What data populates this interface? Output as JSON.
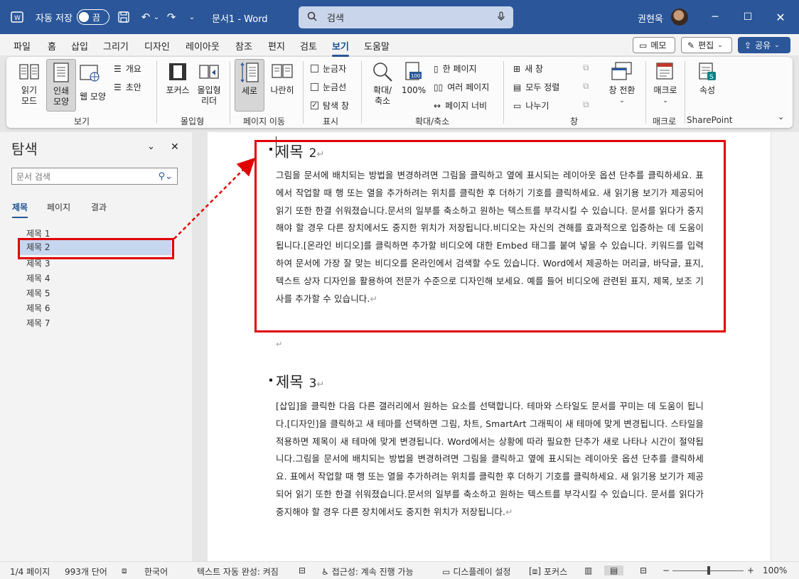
{
  "titlebar": {
    "autosave_label": "자동 저장",
    "autosave_state": "끔",
    "doc_title": "문서1  -  Word",
    "search_placeholder": "검색",
    "user_name": "권현욱"
  },
  "menu": {
    "items": [
      "파일",
      "홈",
      "삽입",
      "그리기",
      "디자인",
      "레이아웃",
      "참조",
      "편지",
      "검토",
      "보기",
      "도움말"
    ],
    "active": "보기",
    "memo": "메모",
    "edit": "편집",
    "share": "공유"
  },
  "ribbon": {
    "read_mode": "읽기\n모드",
    "print_layout": "인쇄\n모양",
    "web_layout": "웹 모양",
    "outline": "개요",
    "draft": "초안",
    "focus": "포커스",
    "immersive_reader": "몰입형\n리더",
    "vertical": "세로",
    "side_by_side": "나란히",
    "ruler": "눈금자",
    "gridlines": "눈금선",
    "nav_pane": "탐색 창",
    "zoom": "확대/\n축소",
    "zoom100": "100%",
    "one_page": "한 페이지",
    "multi_page": "여러 페이지",
    "page_width": "페이지 너비",
    "new_window": "새 창",
    "arrange_all": "모두 정렬",
    "split": "나누기",
    "switch_window": "창 전환",
    "macros": "매크로",
    "properties": "속성",
    "groups": {
      "views": "보기",
      "immersive": "몰입형",
      "page_movement": "페이지 이동",
      "show": "표시",
      "zoom": "확대/축소",
      "window": "창",
      "macros": "매크로",
      "sharepoint": "SharePoint"
    }
  },
  "nav": {
    "title": "탐색",
    "search_placeholder": "문서 검색",
    "tabs": [
      "제목",
      "페이지",
      "결과"
    ],
    "headings": [
      "제목 1",
      "제목 2",
      "제목 3",
      "제목 4",
      "제목 5",
      "제목 6",
      "제목 7"
    ],
    "selected": "제목 2"
  },
  "doc": {
    "heading2": {
      "title": "제목",
      "num": "2"
    },
    "heading3": {
      "title": "제목",
      "num": "3"
    },
    "para1": "그림을 문서에 배치되는 방법을 변경하려면 그림을 클릭하고 옆에 표시되는 레이아웃 옵션 단추를 클릭하세요. 표에서 작업할 때 행 또는 열을 추가하려는 위치를 클릭한 후 더하기 기호를 클릭하세요. 새 읽기용 보기가 제공되어 읽기 또한 한결 쉬워졌습니다.문서의 일부를 축소하고 원하는 텍스트를 부각시킬 수 있습니다. 문서를 읽다가 중지해야 할 경우 다른 장치에서도 중지한 위치가 저장됩니다.비디오는 자신의 견해를 효과적으로 입증하는 데 도움이 됩니다.[온라인 비디오]를 클릭하면 추가할 비디오에 대한 Embed 태그를 붙여 넣을 수 있습니다. 키워드를 입력하여 문서에 가장 잘 맞는 비디오를 온라인에서 검색할 수도 있습니다. Word에서 제공하는 머리글, 바닥글, 표지, 텍스트 상자 디자인을 활용하여 전문가 수준으로 디자인해 보세요. 예를 들어 비디오에 관련된 표지, 제목, 보조 기사를 추가할 수 있습니다.",
    "para2": "[삽입]을 클릭한 다음 다른 갤러리에서 원하는 요소를 선택합니다. 테마와 스타일도 문서를 꾸미는 데 도움이 됩니다.[디자인]을 클릭하고 새 테마를 선택하면 그림, 차트, SmartArt 그래픽이 새 테마에 맞게 변경됩니다. 스타일을 적용하면 제목이 새 테마에 맞게 변경됩니다. Word에서는 상황에 따라 필요한 단추가 새로 나타나 시간이 절약됩니다.그림을 문서에 배치되는 방법을 변경하려면 그림을 클릭하고 옆에 표시되는 레이아웃 옵션 단추를 클릭하세요. 표에서 작업할 때 행 또는 열을 추가하려는 위치를 클릭한 후 더하기 기호를 클릭하세요. 새 읽기용 보기가 제공되어 읽기 또한 한결 쉬워졌습니다.문서의 일부를 축소하고 원하는 텍스트를 부각시킬 수 있습니다. 문서를 읽다가 중지해야 할 경우 다른 장치에서도 중지한 위치가 저장됩니다."
  },
  "status": {
    "page": "1/4 페이지",
    "words": "993개 단어",
    "lang": "한국어",
    "autocomplete": "텍스트 자동 완성: 켜짐",
    "accessibility": "접근성: 계속 진행 가능",
    "display": "디스플레이 설정",
    "focus": "포커스",
    "zoom": "100%"
  },
  "colors": {
    "accent": "#2b579a",
    "highlight": "#e00000"
  }
}
